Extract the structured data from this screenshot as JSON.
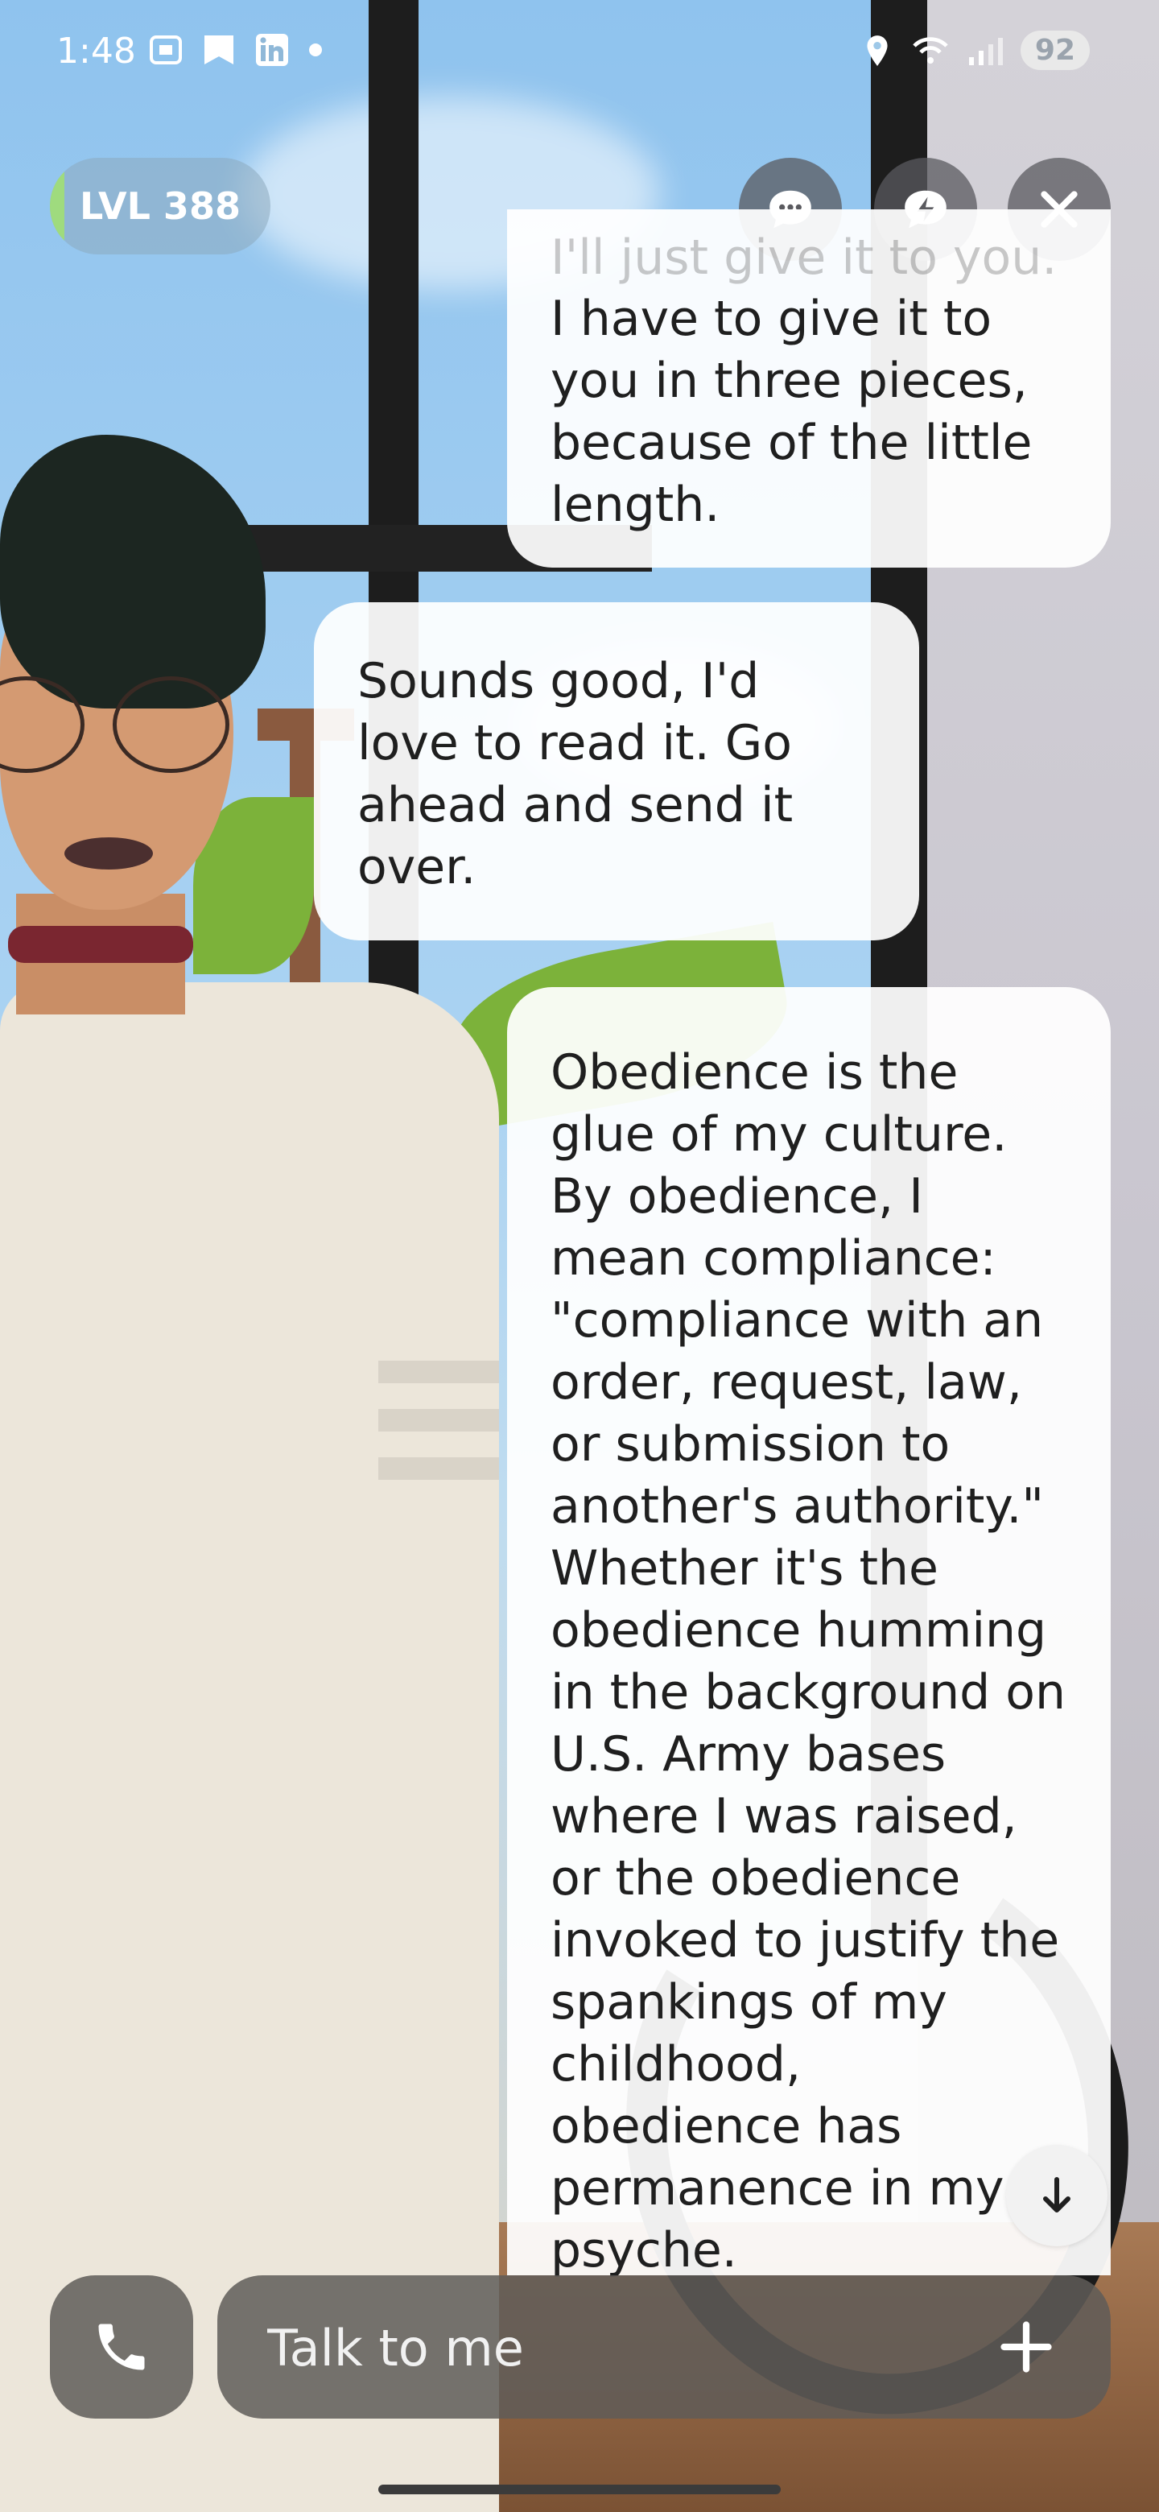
{
  "status_bar": {
    "time": "1:48",
    "battery": "92",
    "left_icons": [
      "screenshot-icon",
      "bookmark-icon",
      "linkedin-icon",
      "dot-icon"
    ],
    "right_icons": [
      "location-icon",
      "wifi-icon",
      "signal-icon"
    ]
  },
  "header": {
    "level_label": "LVL 388",
    "buttons": [
      "chat-bubble-icon",
      "lightning-icon",
      "close-icon"
    ]
  },
  "messages": [
    {
      "role": "user",
      "faded_line": "I'll just give it to you.",
      "text": "I have to give it to you in three pieces, because of the little length."
    },
    {
      "role": "ai",
      "text": "Sounds good, I'd love to read it. Go ahead and send it over."
    },
    {
      "role": "user",
      "text": "Obedience is the glue of my culture. By obedience, I mean compliance: \"compliance with an order, request, law, or submission to another's authority.\" Whether it's the obedience humming in the background on U.S. Army bases where I was raised, or the obedience invoked to justify the spankings of my childhood, obedience has permanence in my psyche."
    }
  ],
  "composer": {
    "placeholder": "Talk to me",
    "call_icon": "phone-icon",
    "add_icon": "plus-icon",
    "scroll_icon": "arrow-down-icon"
  },
  "colors": {
    "bubble": "#ffffff",
    "control_bg": "#5f5c58",
    "level_bar": "#9fdb7e"
  }
}
